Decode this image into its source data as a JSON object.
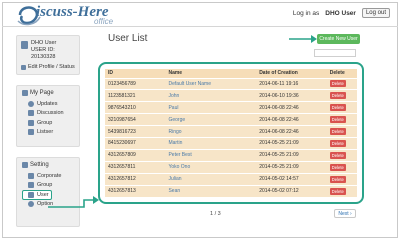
{
  "header": {
    "logo_main": "iscuss-Here",
    "logo_sub": "office",
    "logged_in_label": "Log in as",
    "username": "DHO User",
    "logout_label": "Log out"
  },
  "sidebar": {
    "user_name": "DHO User",
    "user_id": "USER ID: 20130328",
    "edit_profile": "Edit Profile / Status",
    "mypage_title": "My Page",
    "mypage_items": [
      "Updates",
      "Discussion",
      "Group",
      "Listser"
    ],
    "setting_title": "Setting",
    "setting_items": [
      "Corporate",
      "Group",
      "User",
      "Option"
    ]
  },
  "main": {
    "title": "User List",
    "create_button": "Create New User",
    "table": {
      "headers": [
        "ID",
        "Name",
        "Date of Creation",
        "Delete"
      ],
      "delete_label": "Delete",
      "rows": [
        {
          "id": "0123456789",
          "name": "Default User Name",
          "date": "2014-06-11 19:16"
        },
        {
          "id": "1123581321",
          "name": "John",
          "date": "2014-06-10 19:36"
        },
        {
          "id": "9876543210",
          "name": "Paul",
          "date": "2014-06-08 22:46"
        },
        {
          "id": "3210987654",
          "name": "George",
          "date": "2014-06-08 22:46"
        },
        {
          "id": "5439816723",
          "name": "Ringo",
          "date": "2014-06-08 22:46"
        },
        {
          "id": "8415230697",
          "name": "Martin",
          "date": "2014-05-25 21:09"
        },
        {
          "id": "4312657809",
          "name": "Peter Best",
          "date": "2014-05-25 21:09"
        },
        {
          "id": "4312657811",
          "name": "Yoko Ono",
          "date": "2014-05-25 21:09"
        },
        {
          "id": "4312657812",
          "name": "Julian",
          "date": "2014-05-02 14:57"
        },
        {
          "id": "4312657813",
          "name": "Sean",
          "date": "2014-05-02 07:12"
        }
      ]
    },
    "pagination": "1 / 3",
    "next_label": "Next ›"
  },
  "colors": {
    "accent": "#2aa38a",
    "create_button": "#5cb85c",
    "delete_button": "#d9534f",
    "row_bg": "#f7e5c8",
    "header_bg": "#f6ddb8",
    "link": "#4a7aa8"
  }
}
